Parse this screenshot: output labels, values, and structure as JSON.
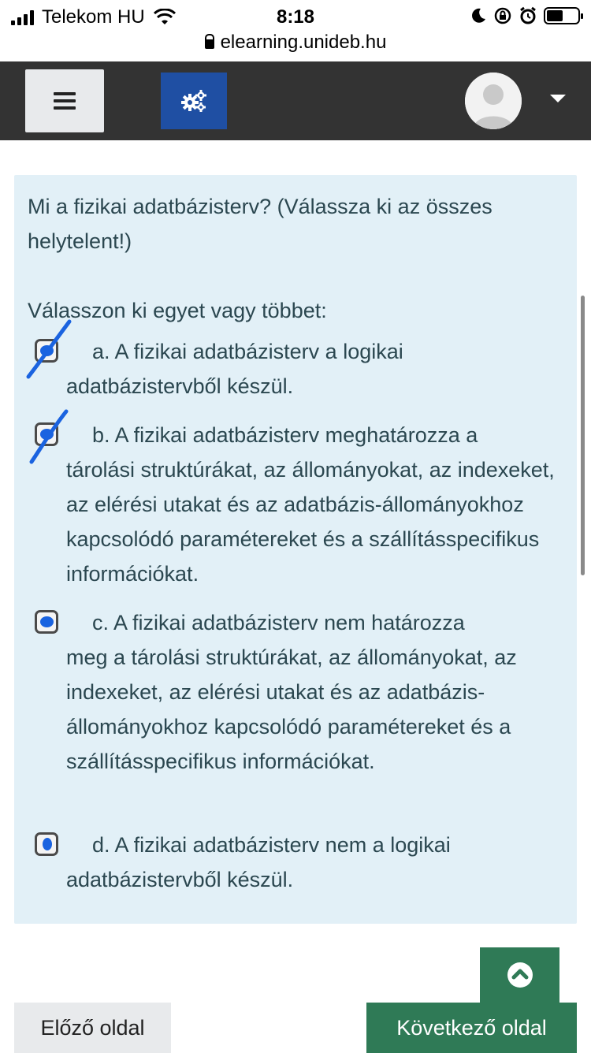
{
  "status_bar": {
    "carrier": "Telekom HU",
    "time": "8:18",
    "icons": [
      "signal-icon",
      "wifi-icon",
      "moon-icon",
      "rotation-lock-icon",
      "alarm-icon",
      "battery-icon"
    ]
  },
  "browser": {
    "url": "elearning.unideb.hu"
  },
  "navbar": {
    "menu_icon": "hamburger-icon",
    "settings_icon": "gears-icon",
    "user_icon": "avatar",
    "dropdown_icon": "caret-down-icon"
  },
  "question": {
    "text": "Mi a fizikai adatbázisterv? (Válassza ki az összes helytelent!)",
    "prompt": "Válasszon ki egyet vagy többet:",
    "answers": [
      {
        "letter": "a.",
        "first": "A fizikai adatbázisterv a logikai",
        "rest": "adatbázistervből készül.",
        "checked": true
      },
      {
        "letter": "b.",
        "first": "A fizikai adatbázisterv meghatározza a",
        "rest": "tárolási struktúrákat, az állományokat, az indexeket, az elérési utakat és az adatbázis-állományokhoz kapcsolódó paramétereket és a szállításspecifikus információkat.",
        "checked": true
      },
      {
        "letter": "c.",
        "first": "A fizikai adatbázisterv nem határozza",
        "rest": "meg a tárolási struktúrákat, az állományokat, az indexeket, az elérési utakat és az adatbázis- állományokhoz kapcsolódó paramétereket és a szállításspecifikus információkat.",
        "checked": false
      },
      {
        "letter": "d.",
        "first": "A fizikai adatbázisterv nem a logikai",
        "rest": "adatbázistervből készül.",
        "checked": false
      }
    ]
  },
  "buttons": {
    "prev": "Előző oldal",
    "next": "Következő oldal",
    "back_to_top_icon": "chevron-up-icon"
  },
  "colors": {
    "navbar": "#333333",
    "settings_button": "#1f4fa3",
    "question_bg": "#e2f0f7",
    "primary_button": "#2f7a56",
    "checkbox_mark": "#1a63e0"
  }
}
